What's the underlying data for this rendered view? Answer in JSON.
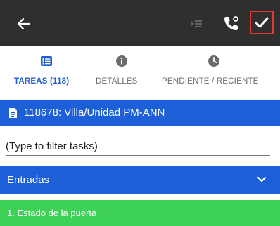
{
  "toolbar": {
    "back_icon": "arrow-left-icon",
    "indent_icon": "indent-icon",
    "call_icon": "phone-call-icon",
    "check_icon": "check-icon",
    "background": "#2f2f2f",
    "highlight_color": "#e53935"
  },
  "tabs": [
    {
      "label": "TAREAS (118)",
      "icon": "list-icon",
      "active": true
    },
    {
      "label": "DETALLES",
      "icon": "info-icon",
      "active": false
    },
    {
      "label": "PENDIENTE / RECIENTE",
      "icon": "clock-icon",
      "active": false
    }
  ],
  "location": {
    "icon": "document-icon",
    "text": "118678: Villa/Unidad PM-ANN",
    "color": "#1d5fd6"
  },
  "filter": {
    "placeholder": "(Type to filter tasks)",
    "value": ""
  },
  "section": {
    "title": "Entradas",
    "icon": "chevron-down-icon",
    "color": "#1d5fd6"
  },
  "tasks": [
    {
      "label": "1. Estado de la puerta",
      "color": "#3ed157"
    }
  ]
}
